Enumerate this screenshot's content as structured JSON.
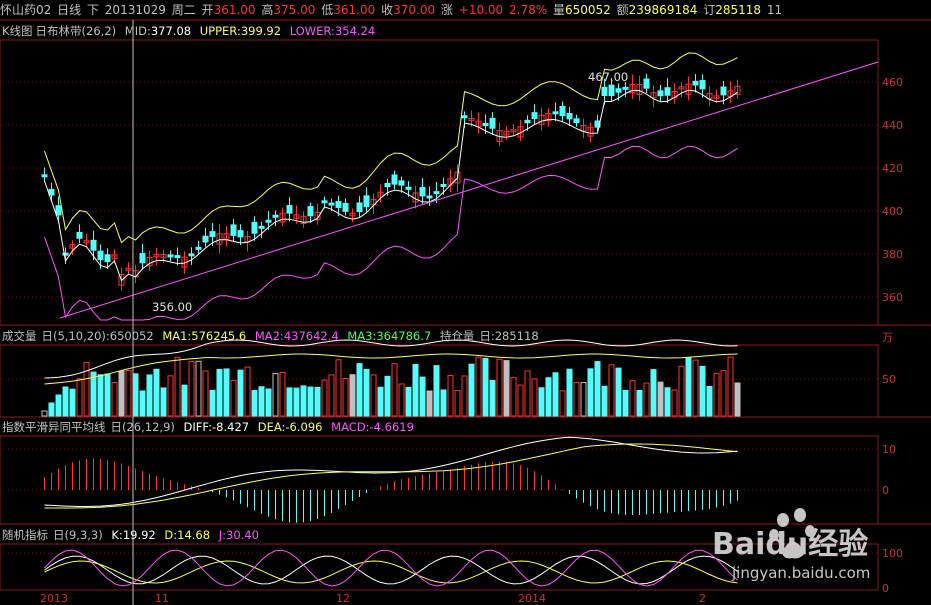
{
  "header": {
    "name": "怀山药02",
    "period": "日线",
    "direction": "下",
    "date": "20131029",
    "weekday": "周二",
    "open_label": "开",
    "open": "361.00",
    "high_label": "高",
    "high": "375.00",
    "low_label": "低",
    "low": "361.00",
    "close_label": "收",
    "close": "370.00",
    "change_label": "涨",
    "change": "+10.00",
    "change_pct": "2.78%",
    "volume_label": "量",
    "volume": "650052",
    "amount_label": "额",
    "amount": "239869184",
    "orders_label": "订",
    "orders": "285118",
    "extra": "11"
  },
  "kline": {
    "title": "K线图",
    "indicator": "日布林带",
    "params": "(26,2)",
    "mid_label": "MID:",
    "mid": "377.08",
    "upper_label": "UPPER:",
    "upper": "399.92",
    "lower_label": "LOWER:",
    "lower": "354.24",
    "axis": [
      "460",
      "440",
      "420",
      "400",
      "380",
      "360"
    ],
    "annotation_high": "467.00",
    "annotation_low": "356.00"
  },
  "volume": {
    "title": "成交量",
    "params": "日(5,10,20)",
    "value": ":650052",
    "ma1_label": "MA1:",
    "ma1": "576245.6",
    "ma2_label": "MA2:",
    "ma2": "437642.4",
    "ma3_label": "MA3:",
    "ma3": "364786.7",
    "oi_label": "持仓量",
    "oi_params": "日",
    "oi": ":285118",
    "axis_unit": "万",
    "axis": [
      "50"
    ]
  },
  "macd": {
    "title": "指数平滑异同平均线",
    "params": "日(26,12,9)",
    "diff_label": "DIFF:",
    "diff": "-8.427",
    "dea_label": "DEA:",
    "dea": "-6.096",
    "macd_label": "MACD:",
    "macd": "-4.6619",
    "axis": [
      "10",
      "0"
    ]
  },
  "kdj": {
    "title": "随机指标",
    "params": "日(9,3,3)",
    "k_label": "K:",
    "k": "19.92",
    "d_label": "D:",
    "d": "14.68",
    "j_label": "J:",
    "j": "30.40",
    "axis": [
      "100",
      "0"
    ]
  },
  "dates": [
    "2013",
    "11",
    "12",
    "2014",
    "2"
  ],
  "watermark": {
    "brand": "Baidu经验",
    "url": "jingyan.baidu.com"
  },
  "colors": {
    "up": "#ff3232",
    "down": "#54fcfc",
    "white_line": "#ffffff",
    "yellow_line": "#ffff54",
    "magenta_line": "#ff54ff",
    "frame": "#8b1a1a",
    "text_red": "#ff3232",
    "text_yellow": "#ffff54",
    "text_magenta": "#ff54ff"
  }
}
